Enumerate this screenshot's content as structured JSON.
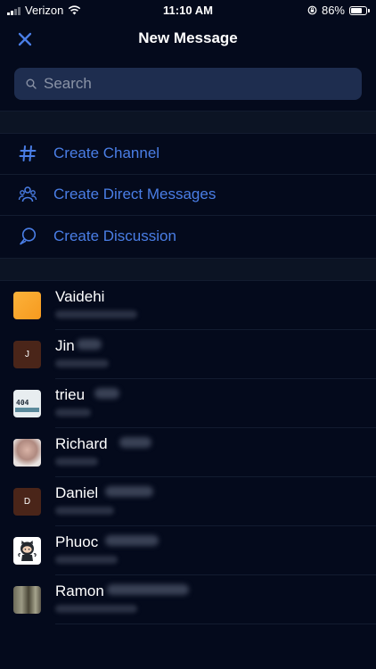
{
  "status": {
    "carrier": "Verizon",
    "time": "11:10 AM",
    "battery": "86%",
    "battery_level": 0.86
  },
  "nav": {
    "title": "New Message"
  },
  "search": {
    "placeholder": "Search"
  },
  "actions": [
    {
      "label": "Create Channel",
      "icon": "hash-icon"
    },
    {
      "label": "Create Direct Messages",
      "icon": "users-icon"
    },
    {
      "label": "Create Discussion",
      "icon": "discussion-icon"
    }
  ],
  "contacts": [
    {
      "name": "Vaidehi",
      "avatar": "orange-square"
    },
    {
      "name": "Jin",
      "avatar_initial": "J"
    },
    {
      "name": "trieu",
      "avatar": "image-avatar"
    },
    {
      "name": "Richard",
      "avatar": "photo-avatar"
    },
    {
      "name": "Daniel",
      "avatar_initial": "D"
    },
    {
      "name": "Phuoc",
      "avatar": "github-avatar"
    },
    {
      "name": "Ramon",
      "avatar": "photo-avatar"
    }
  ],
  "colors": {
    "background": "#040a1c",
    "accent": "#4a7ee6",
    "search_bg": "#1e2d4f"
  }
}
